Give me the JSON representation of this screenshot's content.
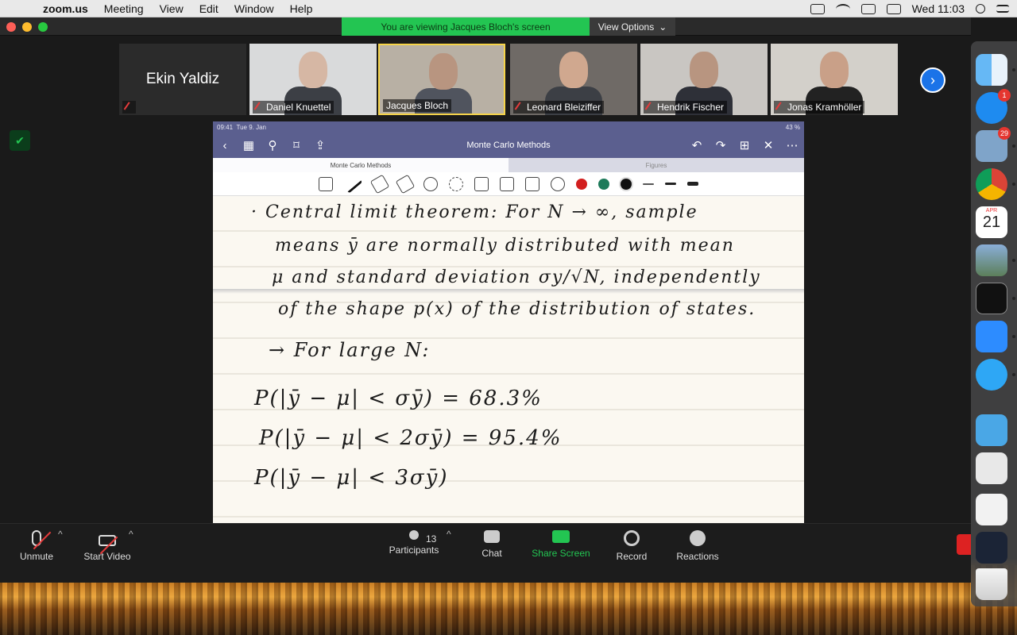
{
  "menubar": {
    "apple": "",
    "app": "zoom.us",
    "items": [
      "Meeting",
      "View",
      "Edit",
      "Window",
      "Help"
    ],
    "clock": "Wed 11:03"
  },
  "banner": {
    "viewing": "You are viewing Jacques Bloch's screen",
    "view_options": "View Options"
  },
  "participants": [
    {
      "name": "Ekin Yaldiz"
    },
    {
      "name": "Daniel Knuettel"
    },
    {
      "name": "Jacques Bloch"
    },
    {
      "name": "Leonard Bleiziffer"
    },
    {
      "name": "Hendrik Fischer"
    },
    {
      "name": "Jonas Kramhöller"
    }
  ],
  "ipad": {
    "time": "09:41",
    "date": "Tue 9. Jan",
    "battery": "43 %",
    "doc_title": "Monte Carlo Methods",
    "tab1": "Monte Carlo Methods",
    "tab2": "Figures"
  },
  "handwriting": [
    "· Central limit theorem: For N → ∞, sample",
    "means ȳ are normally distributed with mean",
    "μ and standard deviation σy/√N, independently",
    "of the shape p(x) of the distribution of states.",
    "→ For large N:",
    "P(|ȳ − μ| < σȳ) = 68.3%",
    "P(|ȳ − μ| < 2σȳ) = 95.4%",
    "P(|ȳ − μ| < 3σȳ)"
  ],
  "controls": {
    "unmute": "Unmute",
    "start_video": "Start Video",
    "participants": "Participants",
    "participant_count": "13",
    "chat": "Chat",
    "share_screen": "Share Screen",
    "record": "Record",
    "reactions": "Reactions"
  },
  "dock": {
    "appstore_badge": "1",
    "mail_badge": "29",
    "calendar_month": "APR",
    "calendar_day": "21"
  },
  "colors": {
    "zoom_green": "#23c552",
    "ipad_nav": "#5b5f8f",
    "active_speaker": "#f6d44a"
  }
}
